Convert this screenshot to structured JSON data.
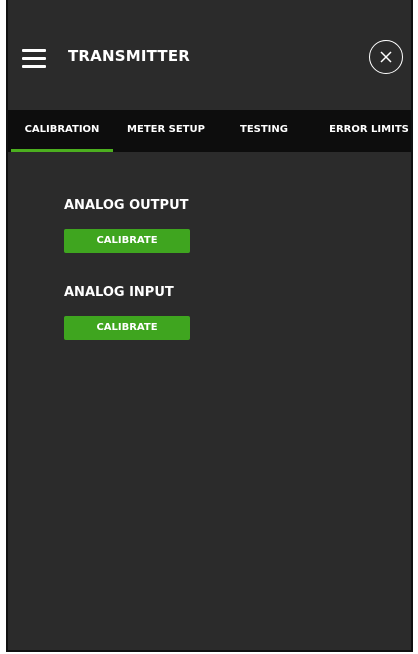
{
  "header": {
    "title": "TRANSMITTER",
    "menu_icon": "hamburger-menu-icon",
    "close_icon": "close-icon"
  },
  "tabs": [
    {
      "label": "CALIBRATION",
      "active": true
    },
    {
      "label": "METER SETUP",
      "active": false
    },
    {
      "label": "TESTING",
      "active": false
    },
    {
      "label": "ERROR LIMITS",
      "active": false
    }
  ],
  "sections": [
    {
      "label": "ANALOG OUTPUT",
      "button_label": "CALIBRATE"
    },
    {
      "label": "ANALOG INPUT",
      "button_label": "CALIBRATE"
    }
  ],
  "colors": {
    "background": "#2b2b2b",
    "tabbar": "#0d0d0d",
    "accent_green": "#3fa51f",
    "active_tab_underline": "#4caf1f",
    "text": "#ffffff"
  }
}
